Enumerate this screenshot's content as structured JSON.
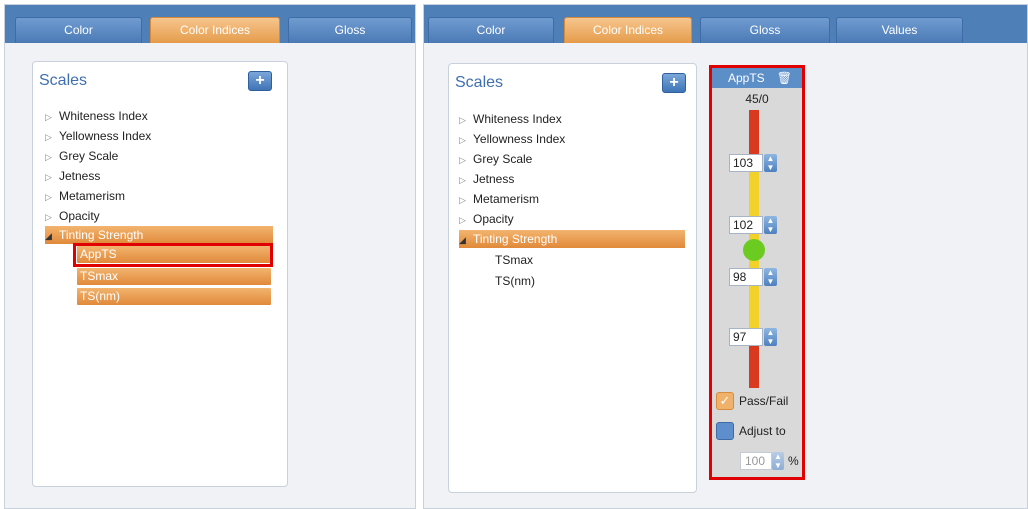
{
  "left": {
    "tabs": [
      {
        "label": "Color",
        "active": false
      },
      {
        "label": "Color Indices",
        "active": true
      },
      {
        "label": "Gloss",
        "active": false
      }
    ],
    "scales_title": "Scales",
    "add_label": "+",
    "tree": [
      {
        "label": "Whiteness Index",
        "icon": "collapsed-arrow-icon"
      },
      {
        "label": "Yellowness Index",
        "icon": "collapsed-arrow-icon"
      },
      {
        "label": "Grey Scale",
        "icon": "collapsed-arrow-icon"
      },
      {
        "label": "Jetness",
        "icon": "collapsed-arrow-icon"
      },
      {
        "label": "Metamerism",
        "icon": "collapsed-arrow-icon"
      },
      {
        "label": "Opacity",
        "icon": "collapsed-arrow-icon"
      },
      {
        "label": "Tinting Strength",
        "icon": "expanded-arrow-icon",
        "expanded": true
      }
    ],
    "children": [
      {
        "label": "AppTS",
        "highlighted": true
      },
      {
        "label": "TSmax",
        "highlighted": false
      },
      {
        "label": "TS(nm)",
        "highlighted": false
      }
    ]
  },
  "right": {
    "tabs": [
      {
        "label": "Color",
        "active": false
      },
      {
        "label": "Color Indices",
        "active": true
      },
      {
        "label": "Gloss",
        "active": false
      },
      {
        "label": "Values",
        "active": false
      }
    ],
    "scales_title": "Scales",
    "add_label": "+",
    "tree": [
      {
        "label": "Whiteness Index",
        "icon": "collapsed-arrow-icon"
      },
      {
        "label": "Yellowness Index",
        "icon": "collapsed-arrow-icon"
      },
      {
        "label": "Grey Scale",
        "icon": "collapsed-arrow-icon"
      },
      {
        "label": "Jetness",
        "icon": "collapsed-arrow-icon"
      },
      {
        "label": "Metamerism",
        "icon": "collapsed-arrow-icon"
      },
      {
        "label": "Opacity",
        "icon": "collapsed-arrow-icon"
      },
      {
        "label": "Tinting Strength",
        "icon": "expanded-arrow-icon",
        "expanded": true
      }
    ],
    "children": [
      {
        "label": "TSmax"
      },
      {
        "label": "TS(nm)"
      }
    ],
    "apps_panel": {
      "title": "AppTS",
      "trash_icon": "trash-icon",
      "range": "45/0",
      "thresholds": [
        "103",
        "102",
        "98",
        "97"
      ],
      "pass_fail_label": "Pass/Fail",
      "pass_fail_checked": true,
      "adjust_label": "Adjust to",
      "adjust_checked": false,
      "adjust_value": "100",
      "adjust_unit": "%"
    }
  },
  "colors": {
    "tab_blue": "#4f7fb7",
    "active_orange": "#e59c4a",
    "fail_red": "#d93a1f",
    "warn_yellow": "#f2d22a",
    "pass_green": "#6ccb21",
    "highlight_red": "#e00000"
  }
}
